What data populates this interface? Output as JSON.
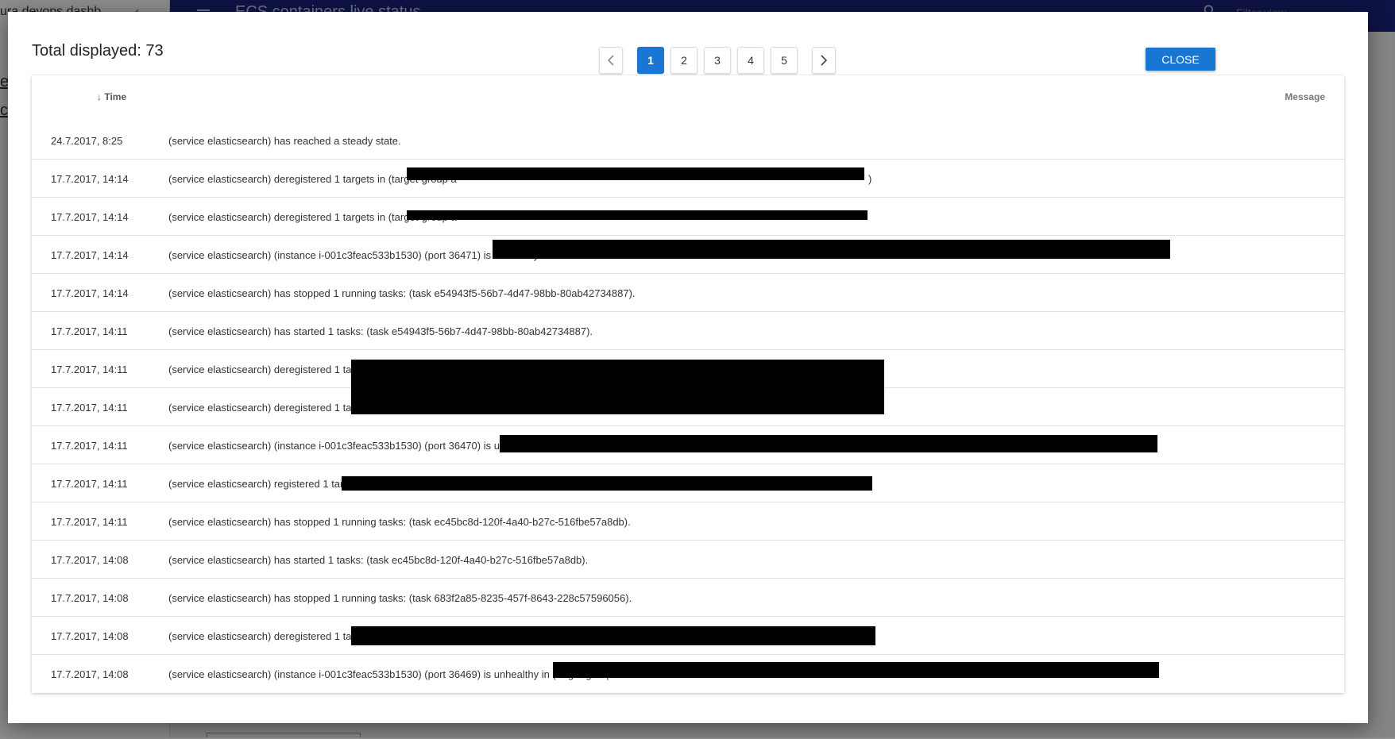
{
  "background": {
    "sidebar_title": "ura devops dashb",
    "sidebar_chevron": "‹",
    "sidebar_link_1": "e",
    "sidebar_link_2": "c",
    "topbar_menu_icon": "menu-icon",
    "topbar_title": "ECS containers live status",
    "search_icon": "search-icon",
    "filter_placeholder": "Filter view"
  },
  "modal": {
    "total_label": "Total displayed: 73",
    "close_label": "CLOSE",
    "pagination": {
      "prev_icon": "chevron-left-icon",
      "next_icon": "chevron-right-icon",
      "pages": [
        "1",
        "2",
        "3",
        "4",
        "5"
      ],
      "active_page": "1"
    },
    "table": {
      "columns": {
        "time": "Time",
        "message": "Message",
        "sort_icon": "arrow-down-icon",
        "sort_glyph": "↓"
      },
      "rows": [
        {
          "time": "24.7.2017, 8:25",
          "message": "(service elasticsearch) has reached a steady state."
        },
        {
          "time": "17.7.2017, 14:14",
          "message": "(service elasticsearch) deregistered 1 targets in (target-group a",
          "suffix": ")"
        },
        {
          "time": "17.7.2017, 14:14",
          "message": "(service elasticsearch) deregistered 1 targets in (target-group a"
        },
        {
          "time": "17.7.2017, 14:14",
          "message": "(service elasticsearch) (instance i-001c3feac533b1530) (port 36471) is unhealthy in"
        },
        {
          "time": "17.7.2017, 14:14",
          "message": "(service elasticsearch) has stopped 1 running tasks: (task e54943f5-56b7-4d47-98bb-80ab42734887)."
        },
        {
          "time": "17.7.2017, 14:11",
          "message": "(service elasticsearch) has started 1 tasks: (task e54943f5-56b7-4d47-98bb-80ab42734887)."
        },
        {
          "time": "17.7.2017, 14:11",
          "message": "(service elasticsearch) deregistered 1 targets in"
        },
        {
          "time": "17.7.2017, 14:11",
          "message": "(service elasticsearch) deregistered 1 targets in"
        },
        {
          "time": "17.7.2017, 14:11",
          "message": "(service elasticsearch) (instance i-001c3feac533b1530) (port 36470) is unhealthy in ("
        },
        {
          "time": "17.7.2017, 14:11",
          "message": "(service elasticsearch) registered 1 targets in"
        },
        {
          "time": "17.7.2017, 14:11",
          "message": "(service elasticsearch) has stopped 1 running tasks: (task ec45bc8d-120f-4a40-b27c-516fbe57a8db)."
        },
        {
          "time": "17.7.2017, 14:08",
          "message": "(service elasticsearch) has started 1 tasks: (task ec45bc8d-120f-4a40-b27c-516fbe57a8db)."
        },
        {
          "time": "17.7.2017, 14:08",
          "message": "(service elasticsearch) has stopped 1 running tasks: (task 683f2a85-8235-457f-8643-228c57596056)."
        },
        {
          "time": "17.7.2017, 14:08",
          "message": "(service elasticsearch) deregistered 1 targets in"
        },
        {
          "time": "17.7.2017, 14:08",
          "message": "(service elasticsearch) (instance i-001c3feac533b1530) (port 36469) is unhealthy in (target-group"
        }
      ]
    }
  },
  "colors": {
    "accent": "#1976d2",
    "topbar": "#1a237e"
  }
}
